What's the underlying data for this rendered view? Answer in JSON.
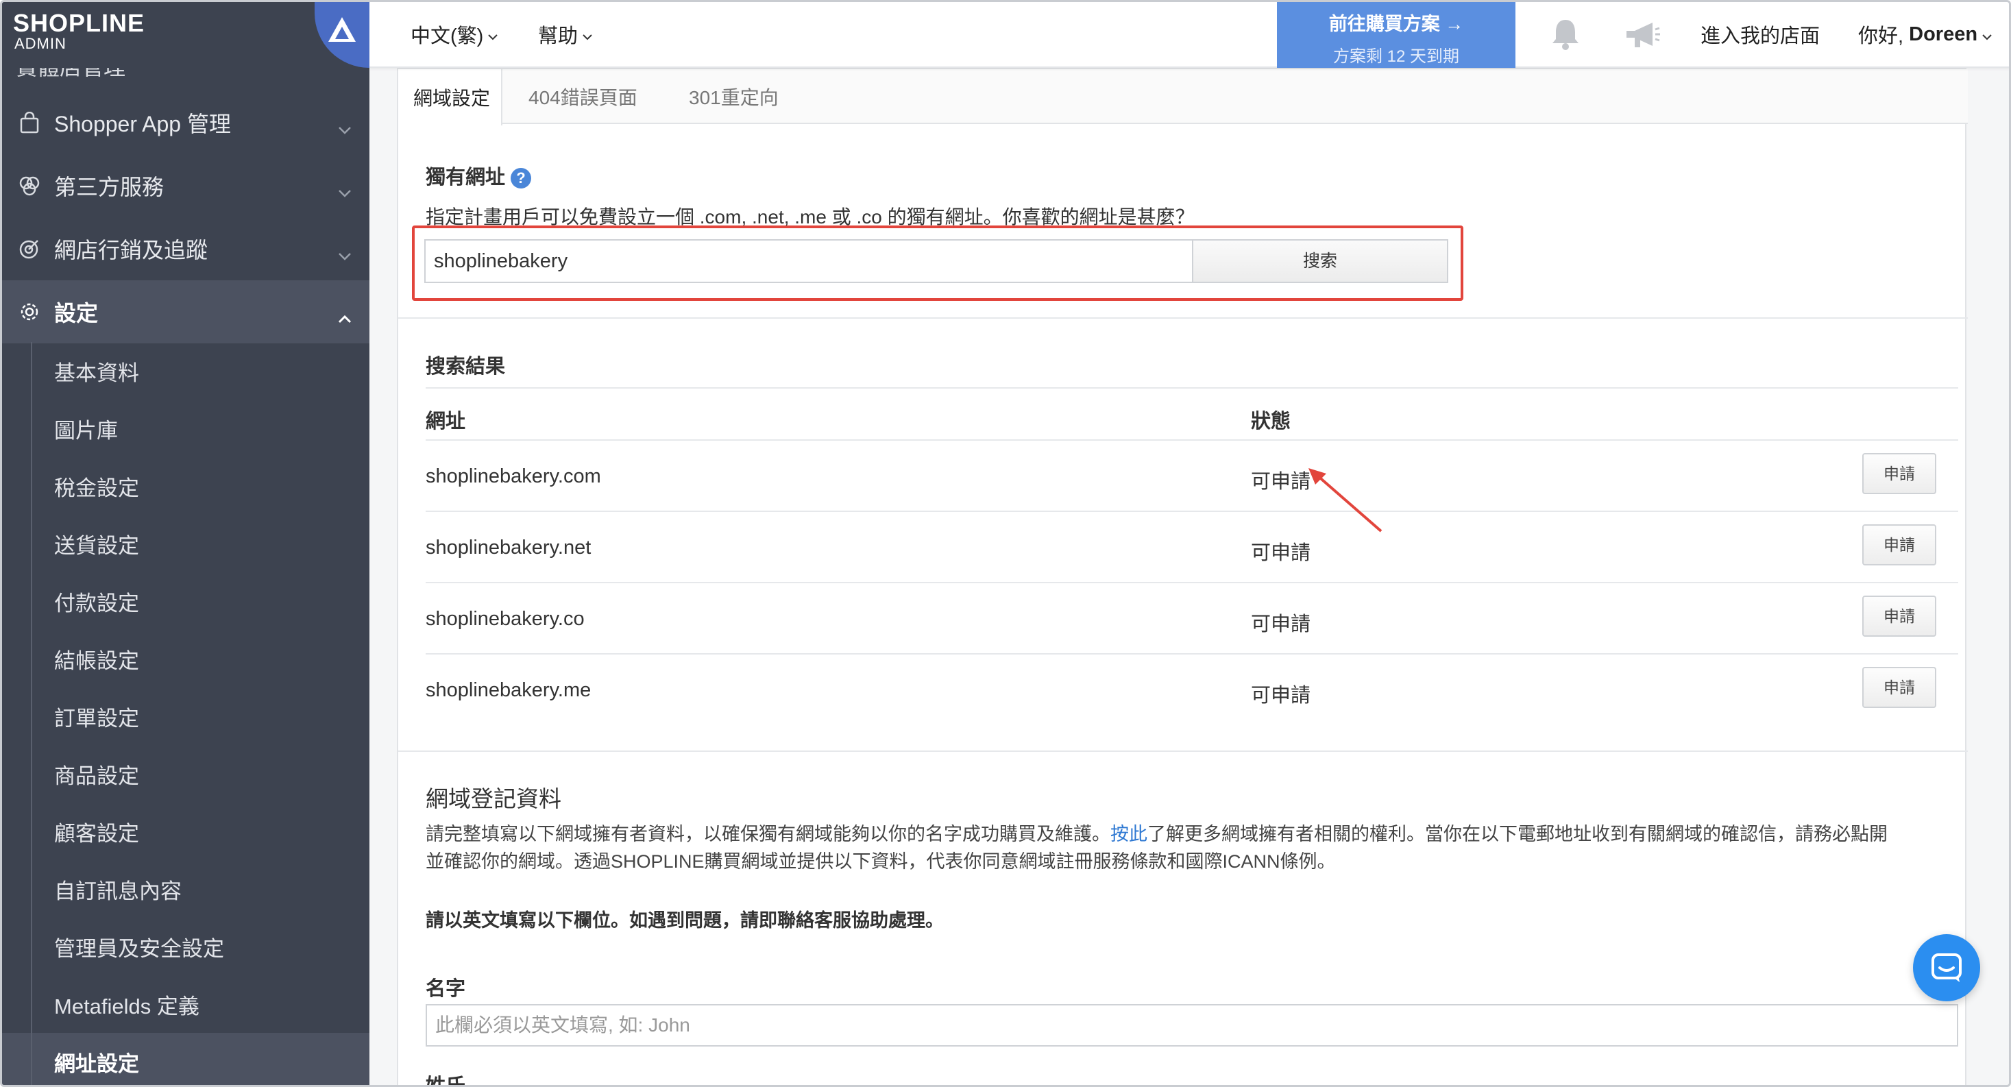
{
  "brand": {
    "logo": "SHOPLINE",
    "sub": "ADMIN",
    "accent": "#4a6cc4"
  },
  "sidebar": {
    "cut_item": "實體店管理",
    "items": [
      {
        "label": "Shopper App 管理",
        "icon": "shopping-bag-icon"
      },
      {
        "label": "第三方服務",
        "icon": "circles-icon"
      },
      {
        "label": "網店行銷及追蹤",
        "icon": "target-icon"
      },
      {
        "label": "設定",
        "icon": "gear-icon"
      }
    ],
    "sub_items": [
      {
        "label": "基本資料"
      },
      {
        "label": "圖片庫"
      },
      {
        "label": "稅金設定"
      },
      {
        "label": "送貨設定"
      },
      {
        "label": "付款設定"
      },
      {
        "label": "結帳設定"
      },
      {
        "label": "訂單設定"
      },
      {
        "label": "商品設定"
      },
      {
        "label": "顧客設定"
      },
      {
        "label": "自訂訊息內容"
      },
      {
        "label": "管理員及安全設定"
      },
      {
        "label": "Metafields 定義"
      },
      {
        "label": "網址設定"
      }
    ]
  },
  "topbar": {
    "language": "中文(繁)",
    "help": "幫助",
    "upgrade_title": "前往購買方案 →",
    "upgrade_sub": "方案剩 12 天到期",
    "visit_store": "進入我的店面",
    "greeting": "你好, ",
    "user": "Doreen"
  },
  "tabs": [
    {
      "label": "網域設定"
    },
    {
      "label": "404錯誤頁面"
    },
    {
      "label": "301重定向"
    }
  ],
  "domain": {
    "title": "獨有網址",
    "desc": "指定計畫用戶可以免費設立一個 .com, .net, .me 或 .co 的獨有網址。你喜歡的網址是甚麼？",
    "search_value": "shoplinebakery",
    "search_button": "搜索"
  },
  "results": {
    "title": "搜索結果",
    "col_url": "網址",
    "col_status": "狀態",
    "apply_label": "申請",
    "rows": [
      {
        "url": "shoplinebakery.com",
        "status": "可申請"
      },
      {
        "url": "shoplinebakery.net",
        "status": "可申請"
      },
      {
        "url": "shoplinebakery.co",
        "status": "可申請"
      },
      {
        "url": "shoplinebakery.me",
        "status": "可申請"
      }
    ]
  },
  "registration": {
    "title": "網域登記資料",
    "para_a": "請完整填寫以下網域擁有者資料，以確保獨有網域能夠以你的名字成功購買及維護。",
    "link": "按此",
    "para_b": "了解更多網域擁有者相關的權利。當你在以下電郵地址收到有關網域的確認信，請務必點開",
    "para_c": "並確認你的網域。透過SHOPLINE購買網域並提供以下資料，代表你同意網域註冊服務條款和國際ICANN條例。",
    "notice": "請以英文填寫以下欄位。如遇到問題，請即聯絡客服協助處理。",
    "name_label": "名字",
    "name_placeholder": "此欄必須以英文填寫, 如: John",
    "surname_label": "姓氏"
  }
}
